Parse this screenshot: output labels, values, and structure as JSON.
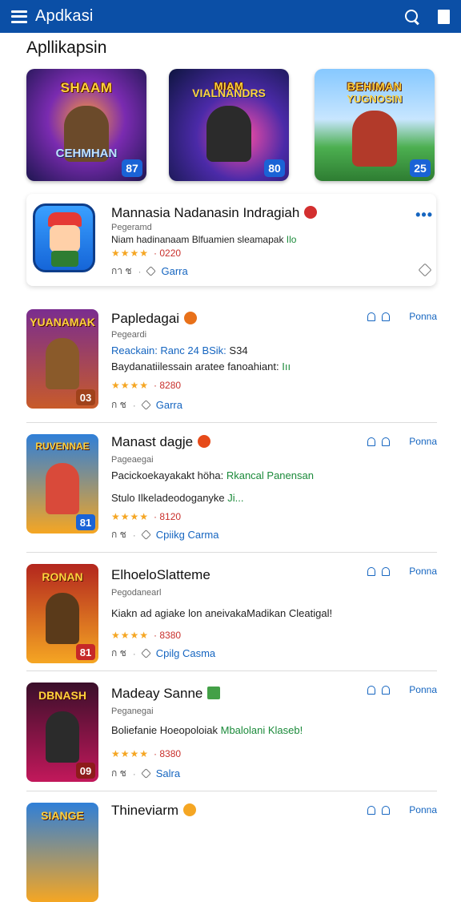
{
  "topbar": {
    "title": "Apdkasi"
  },
  "section": {
    "title": "Apllikapsin"
  },
  "featured": [
    {
      "title": "SHAAM",
      "subtitle": "CEHMHAN",
      "badge": "87"
    },
    {
      "title": "MIAM",
      "subtitle": "VIALNANDRS",
      "badge": "80"
    },
    {
      "title": "BEHIMAN",
      "subtitle": "YUGNOSIN",
      "badge": "25"
    }
  ],
  "highlight": {
    "name": "Mannasia Nadanasin Indragiah",
    "developer": "Pegeramd",
    "desc": "Niam hadinanaam Blfuamien sleamapak",
    "desc_tag": "Ilo",
    "stars": "★★★★",
    "price": "· 0220",
    "meta1": "กา ช",
    "link": "Garra"
  },
  "apps": [
    {
      "thumb_title": "YUANAMAK",
      "badge": "03",
      "name": "Papledagai",
      "developer": "Pegeardi",
      "desc_a": "Reackain: Ranc 24 BSik:",
      "desc_b": "S34",
      "desc2": "Baydanatiilessain aratee fanoahiant:",
      "desc2_tag": "Iıı",
      "stars": "★★★★",
      "price": "· 8280",
      "meta1": "ก ช",
      "link": "Garra",
      "action": "Ponna"
    },
    {
      "thumb_title": "RUVENNAE",
      "badge": "81",
      "name": "Manast dagje",
      "developer": "Pageaegai",
      "desc_a": "Pacickoekayakakt höha:",
      "desc_b": "Rkancal Panensan",
      "desc2": "Stulo Ilkeladeodoganyke",
      "desc2_tag": "Ji...",
      "stars": "★★★★",
      "price": "· 8120",
      "meta1": "ก ช",
      "link": "Cpiikg Carma",
      "action": "Ponna"
    },
    {
      "thumb_title": "RONAN",
      "badge": "81",
      "name": "ElhoeloSlatteme",
      "developer": "Pegodanearl",
      "desc_a": "Kiakn ad agiake lon aneivakaMadikan Cleatigal!",
      "desc_b": "",
      "desc2": "",
      "desc2_tag": "",
      "stars": "★★★★",
      "price": "· 8380",
      "meta1": "ก ช",
      "link": "Cpilg Casma",
      "action": "Ponna"
    },
    {
      "thumb_title": "DBNASH",
      "badge": "09",
      "name": "Madeay Sanne",
      "developer": "Peganegai",
      "desc_a": "Boliefanie Hoeopoloiak",
      "desc_b": "Mbalolani Klaseb!",
      "desc2": "",
      "desc2_tag": "",
      "stars": "★★★★",
      "price": "· 8380",
      "meta1": "ก ช",
      "link": "Salra",
      "action": "Ponna"
    },
    {
      "thumb_title": "SIANGE",
      "badge": "",
      "name": "Thineviarm",
      "developer": "",
      "desc_a": "",
      "desc_b": "",
      "desc2": "",
      "desc2_tag": "",
      "stars": "",
      "price": "",
      "meta1": "",
      "link": "",
      "action": "Ponna"
    }
  ]
}
